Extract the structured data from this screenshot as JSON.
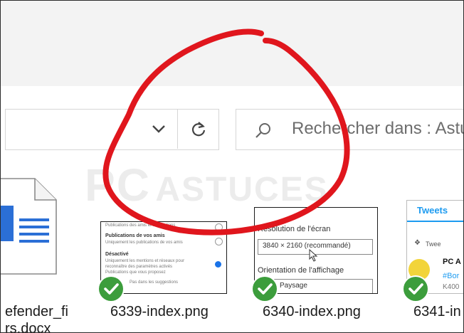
{
  "toolbar": {
    "search_placeholder": "Rechercher dans : Astuc",
    "dropdown_icon": "chevron-down-icon",
    "refresh_icon": "refresh-icon",
    "search_icon": "search-icon"
  },
  "watermark": {
    "text_1": "PC",
    "text_2": "ASTUCES"
  },
  "files": [
    {
      "name_line1": "efender_fi",
      "name_line2": "rs.docx"
    },
    {
      "name": "6339-index.png",
      "preview": {
        "lines": [
          "Publications des amis et suggestions",
          "Publications de vos amis",
          "Uniquement les publications de vos amis",
          "Désactivé",
          "Uniquement les mentions et réseaux pour",
          "reconnaître des paramètres activés",
          "Publications que vous proposez",
          "Pas dans les suggestions"
        ]
      }
    },
    {
      "name": "6340-index.png",
      "preview": {
        "label_res": "Résolution de l'écran",
        "value_res": "3840 × 2160 (recommandé)",
        "label_orient": "Orientation de l'affichage",
        "value_orient": "Paysage"
      }
    },
    {
      "name": "6341-in",
      "preview": {
        "header": "Tweets",
        "pinned": "Twee",
        "account": "PC A",
        "hashtag": "#Bor",
        "code": "K400"
      }
    }
  ],
  "colors": {
    "annotation_red": "#e0161d",
    "check_green": "#3c9d3c",
    "twitter_blue": "#1d9bf0",
    "doc_blue": "#2b6fd6"
  }
}
